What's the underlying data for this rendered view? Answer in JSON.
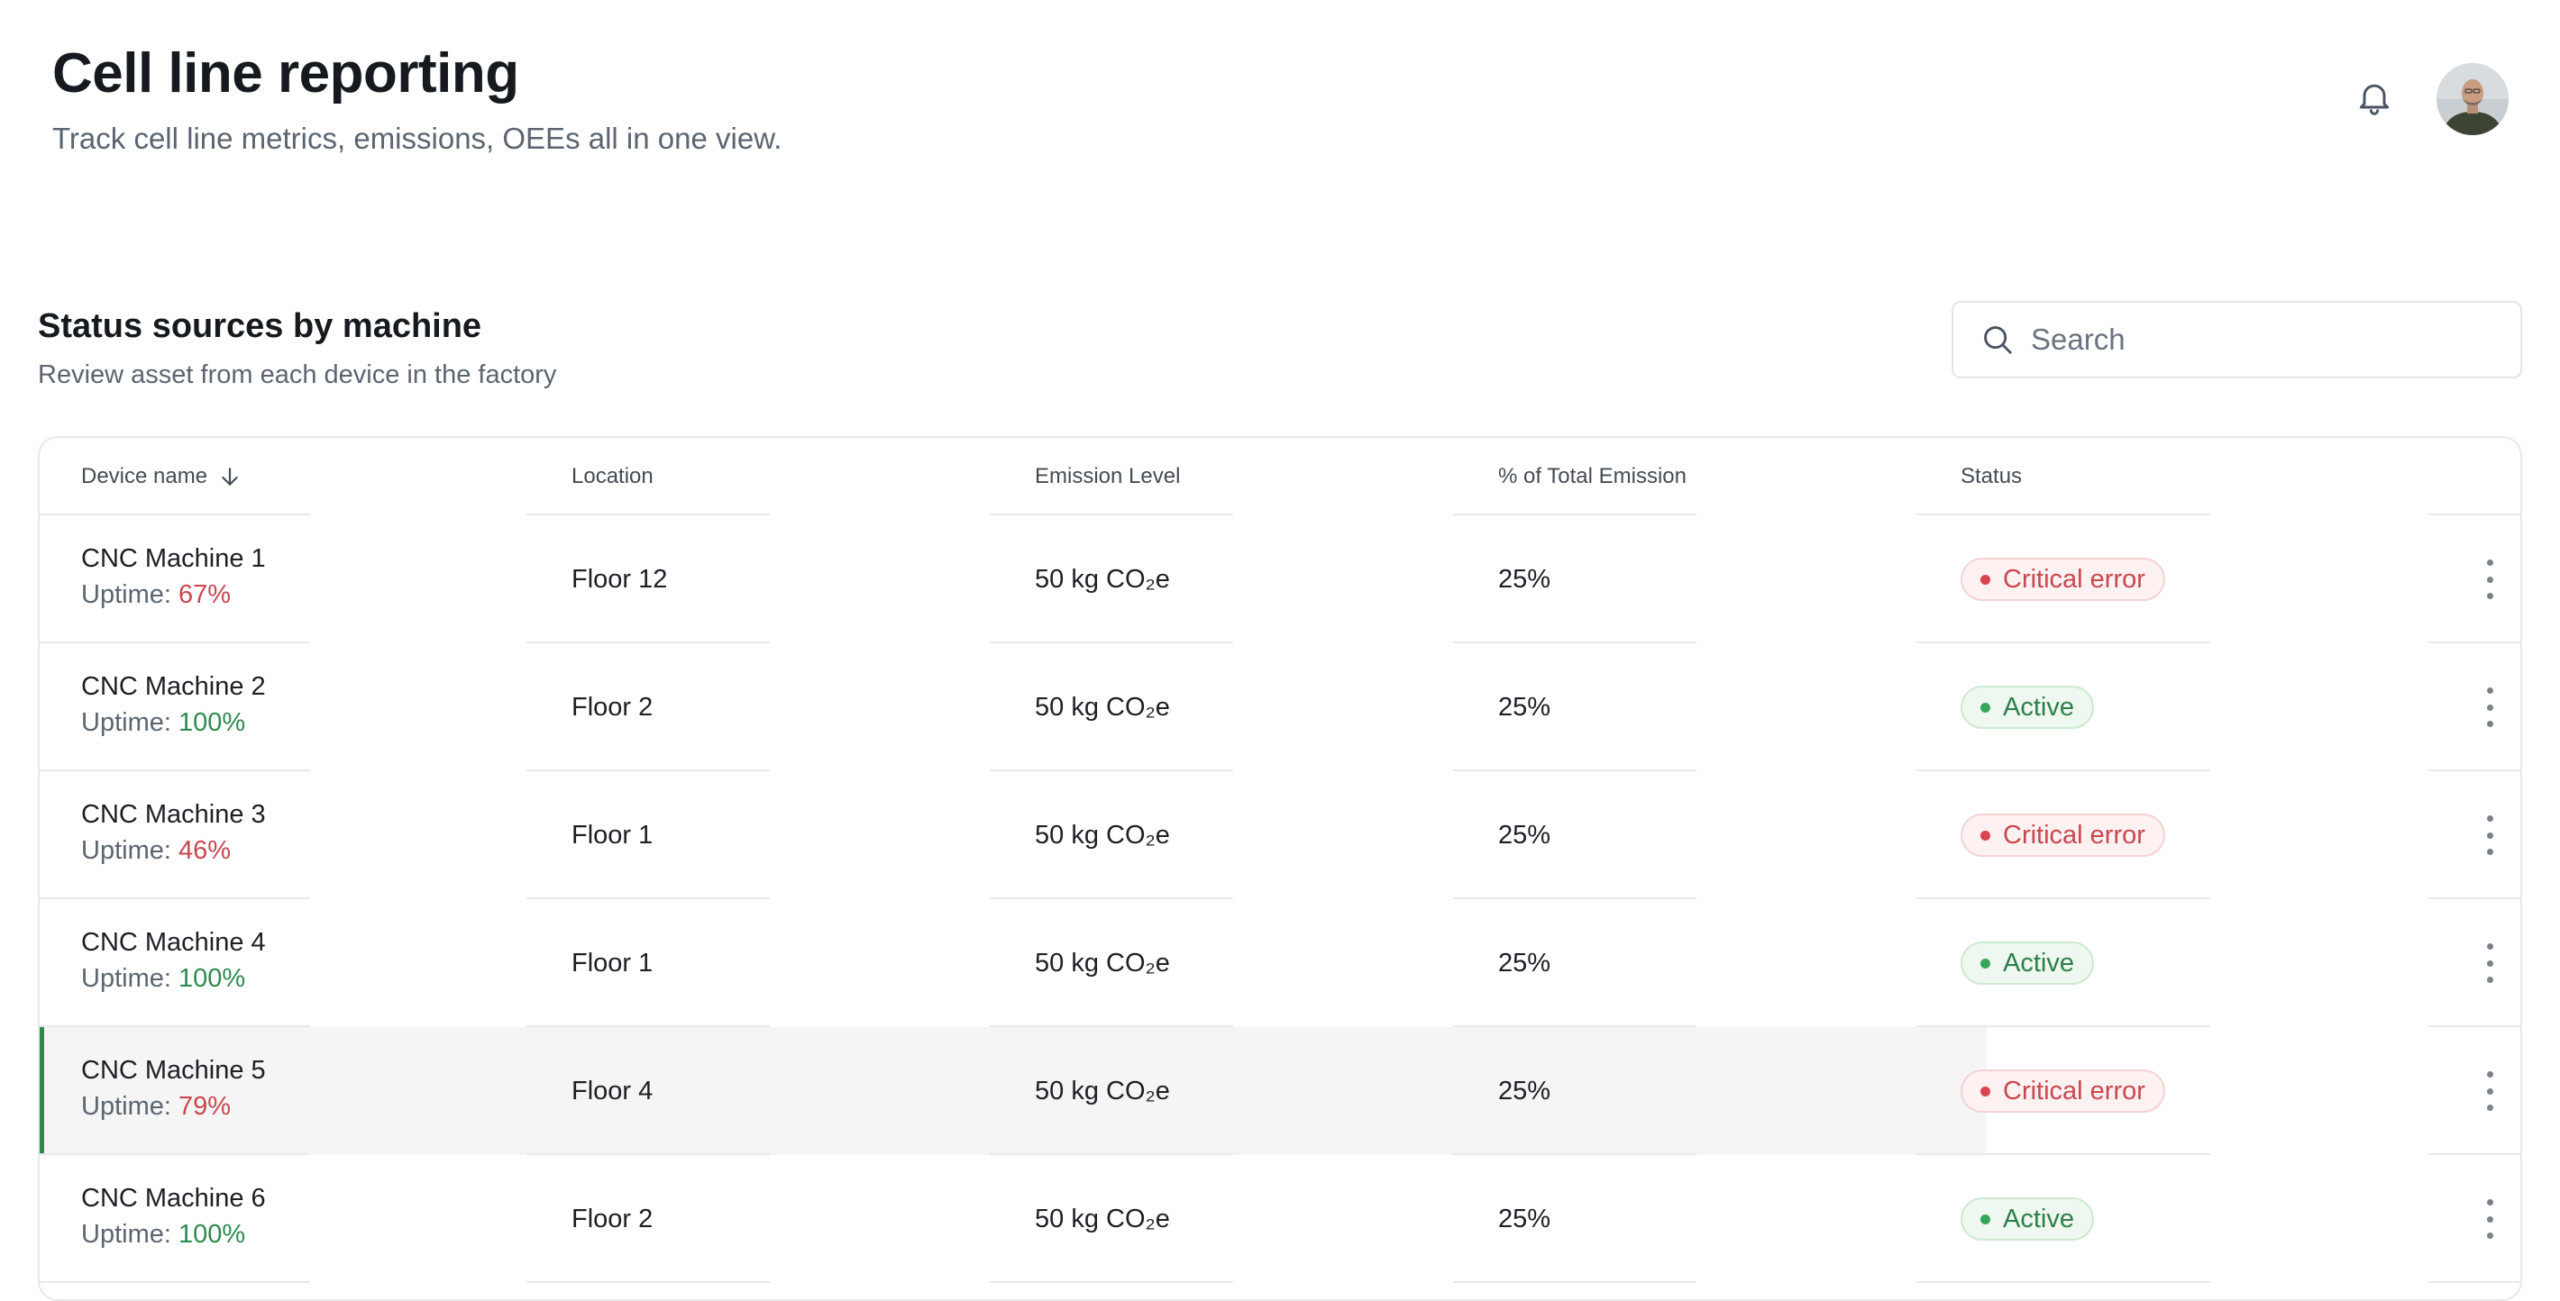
{
  "header": {
    "title": "Cell line reporting",
    "subtitle": "Track cell line metrics, emissions, OEEs all in one view.",
    "notification_icon": "bell-icon",
    "avatar_icon": "user-avatar"
  },
  "section": {
    "title": "Status sources by machine",
    "subtitle": "Review asset from each device in the factory"
  },
  "search": {
    "placeholder": "Search",
    "value": "",
    "icon": "search-icon"
  },
  "table": {
    "columns": [
      {
        "label": "Device name",
        "sort": "descending"
      },
      {
        "label": "Location"
      },
      {
        "label": "Emission Level"
      },
      {
        "label": "% of Total Emission"
      },
      {
        "label": "Status"
      }
    ],
    "uptime_label": "Uptime:",
    "rows": [
      {
        "device": "CNC Machine 1",
        "uptime": "67%",
        "uptime_status": "bad",
        "location": "Floor 12",
        "emission": "50 kg CO₂e",
        "share": "25%",
        "status": "Critical error",
        "status_kind": "error"
      },
      {
        "device": "CNC Machine 2",
        "uptime": "100%",
        "uptime_status": "good",
        "location": "Floor 2",
        "emission": "50 kg CO₂e",
        "share": "25%",
        "status": "Active",
        "status_kind": "active"
      },
      {
        "device": "CNC Machine 3",
        "uptime": "46%",
        "uptime_status": "bad",
        "location": "Floor 1",
        "emission": "50 kg CO₂e",
        "share": "25%",
        "status": "Critical error",
        "status_kind": "error"
      },
      {
        "device": "CNC Machine 4",
        "uptime": "100%",
        "uptime_status": "good",
        "location": "Floor 1",
        "emission": "50 kg CO₂e",
        "share": "25%",
        "status": "Active",
        "status_kind": "active"
      },
      {
        "device": "CNC Machine 5",
        "uptime": "79%",
        "uptime_status": "bad",
        "location": "Floor 4",
        "emission": "50 kg CO₂e",
        "share": "25%",
        "status": "Critical error",
        "status_kind": "error",
        "highlighted": true
      },
      {
        "device": "CNC Machine 6",
        "uptime": "100%",
        "uptime_status": "good",
        "location": "Floor 2",
        "emission": "50 kg CO₂e",
        "share": "25%",
        "status": "Active",
        "status_kind": "active"
      }
    ]
  },
  "colors": {
    "error": "#c9474f",
    "active": "#2d7f49",
    "highlight_bar": "#2c8a4a"
  }
}
